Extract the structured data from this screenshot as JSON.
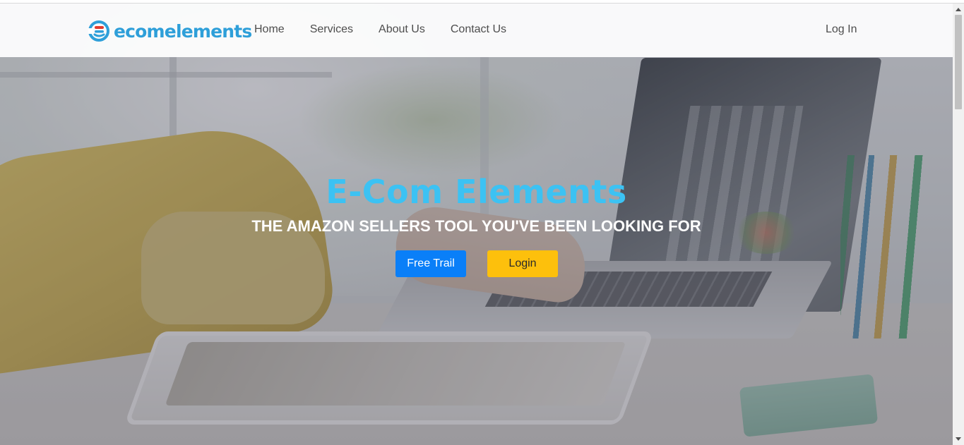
{
  "header": {
    "logo_text": "ecomelements",
    "nav": [
      {
        "label": "Home"
      },
      {
        "label": "Services"
      },
      {
        "label": "About Us"
      },
      {
        "label": "Contact Us"
      }
    ],
    "login_label": "Log In"
  },
  "hero": {
    "title": "E-Com Elements",
    "subtitle": "THE AMAZON SELLERS TOOL YOU'VE BEEN LOOKING FOR",
    "primary_button": "Free Trail",
    "secondary_button": "Login"
  },
  "colors": {
    "brand": "#2e9fd9",
    "title": "#3cc2f3",
    "primary_button": "#0a7ff8",
    "secondary_button": "#fdc00c"
  },
  "icons": {
    "logo": "ecomelements-logo-icon",
    "scroll_up": "scroll-up-arrow-icon",
    "scroll_down": "scroll-down-arrow-icon"
  }
}
